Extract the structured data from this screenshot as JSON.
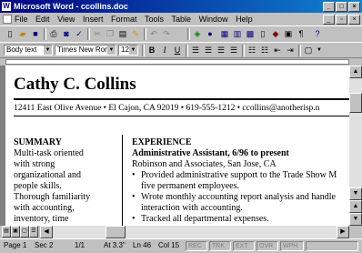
{
  "window": {
    "title": "Microsoft Word - ccollins.doc"
  },
  "menubar": {
    "items": [
      "File",
      "Edit",
      "View",
      "Insert",
      "Format",
      "Tools",
      "Table",
      "Window",
      "Help"
    ]
  },
  "formatting": {
    "style": "Body text",
    "font": "Times New Roman",
    "size": "12"
  },
  "document": {
    "name": "Cathy C. Collins",
    "contact": "12411 East Olive Avenue  •  El Cajon, CA 92019  •  619-555-1212  •  ccollins@anotherisp.n",
    "summary_heading": "SUMMARY",
    "summary_lines": [
      "Multi-task oriented",
      "with strong",
      "organizational and",
      "people skills.",
      "Thorough familiarity",
      "with accounting,",
      "inventory, time"
    ],
    "experience_heading": "EXPERIENCE",
    "job_title": "Administrative Assistant, 6/96 to present",
    "employer": "Robinson and Associates, San Jose, CA",
    "bullet_lines": [
      "•",
      "Provided administrative support to the Trade Show M",
      "five permanent employees.",
      "•",
      "Wrote monthly accounting report analysis and handle",
      "interaction with accounting.",
      "•",
      "Tracked all departmental expenses."
    ]
  },
  "statusbar": {
    "page": "Page  1",
    "section": "Sec  2",
    "pages": "1/1",
    "at": "At  3.3\"",
    "line": "Ln  46",
    "col": "Col  15",
    "modes": [
      "REC",
      "TRK",
      "EXT",
      "OVR",
      "WPH"
    ]
  }
}
